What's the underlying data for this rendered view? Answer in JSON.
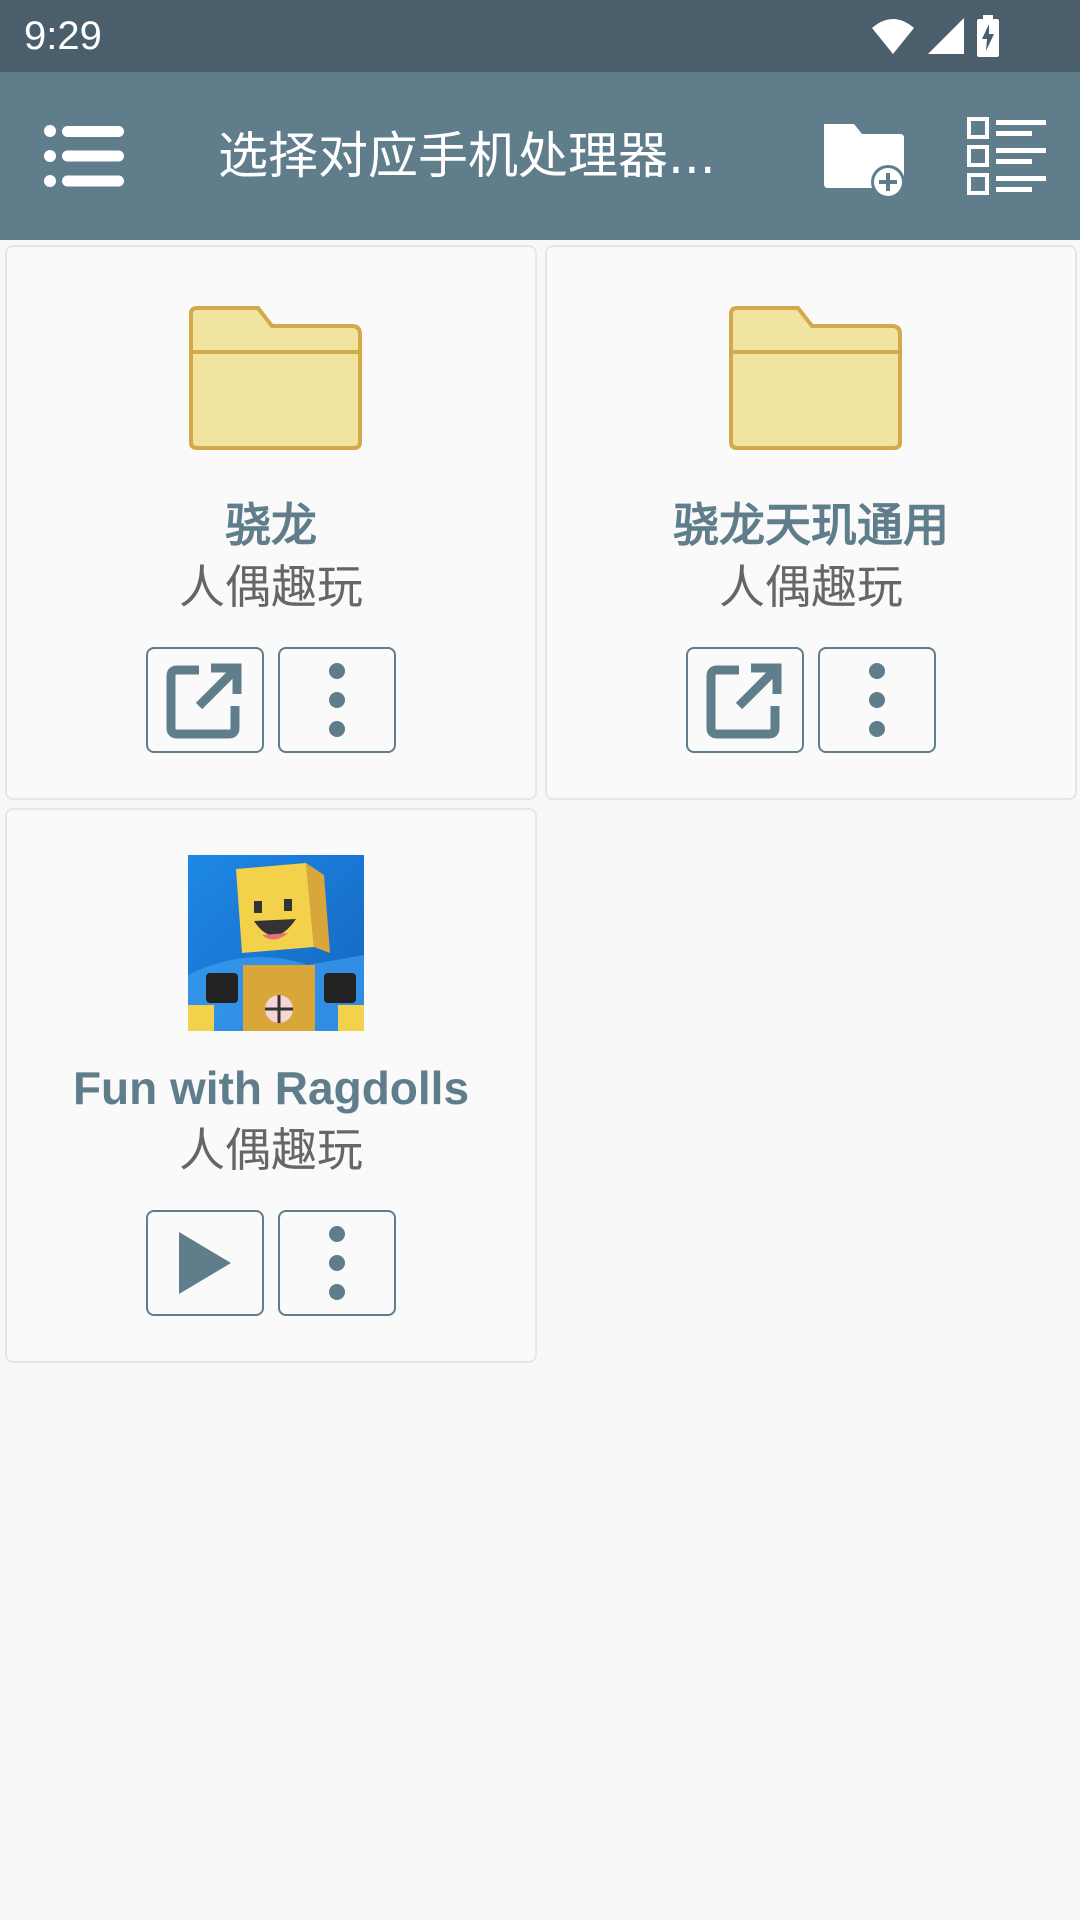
{
  "status_bar": {
    "time": "9:29",
    "icons": [
      "wifi-icon",
      "cell-signal-icon",
      "battery-charging-icon"
    ]
  },
  "toolbar": {
    "title": "选择对应手机处理器...",
    "icons": [
      "menu-icon",
      "new-folder-icon",
      "list-view-icon"
    ],
    "color": "#607d8b"
  },
  "items": [
    {
      "name": "骁龙",
      "subtitle": "人偶趣玩",
      "type": "folder",
      "primary_action_icon": "open-external-icon",
      "secondary_action_icon": "more-vert-icon"
    },
    {
      "name": "骁龙天玑通用",
      "subtitle": "人偶趣玩",
      "type": "folder",
      "primary_action_icon": "open-external-icon",
      "secondary_action_icon": "more-vert-icon"
    },
    {
      "name": "Fun with Ragdolls",
      "subtitle": "人偶趣玩",
      "type": "app",
      "primary_action_icon": "play-icon",
      "secondary_action_icon": "more-vert-icon"
    }
  ],
  "colors": {
    "status_bar": "#4a5f6b",
    "accent": "#607d8b",
    "folder_fill": "#f0e4a0",
    "folder_stroke": "#d4a94a"
  }
}
